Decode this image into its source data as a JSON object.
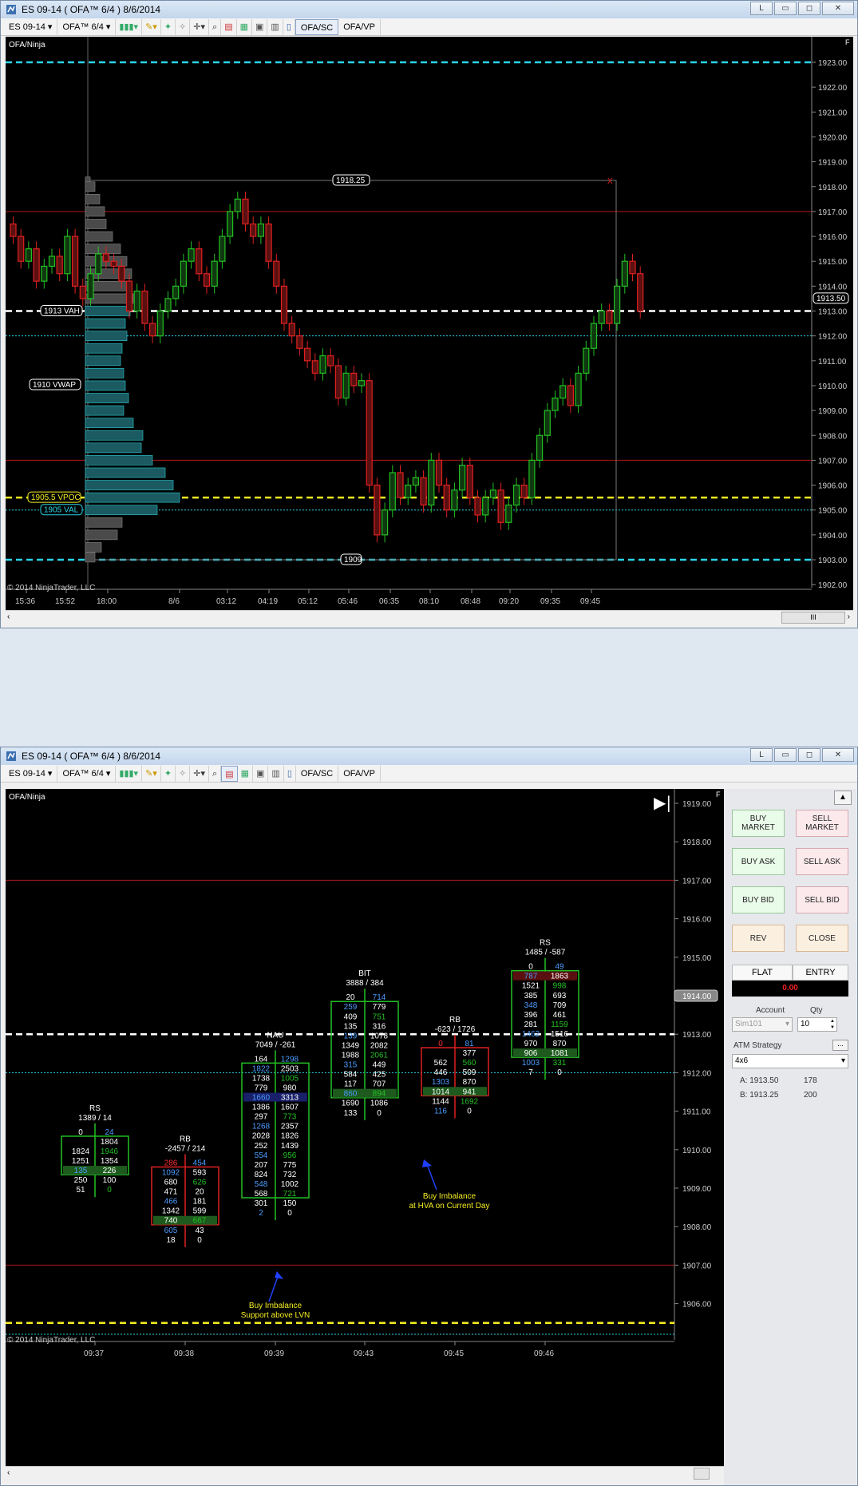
{
  "top_window": {
    "title": "ES 09-14 ( OFA™ 6/4 )  8/6/2014",
    "buttons": [
      "L",
      "▭",
      "◻",
      "✕"
    ],
    "toolbar": {
      "instrument": "ES 09-14",
      "template": "OFA™ 6/4",
      "tab1": "OFA/SC",
      "tab2": "OFA/VP"
    },
    "chart": {
      "label": "OFA/Ninja",
      "copyright": "© 2014 NinjaTrader, LLC",
      "price_box_top": "1918.25",
      "price_box_bottom": "1909",
      "last_price": "1913.50",
      "vwap": "1910 VWAP",
      "vah": "1913 VAH",
      "vpoc": "1905.5 VPOC",
      "val": "1905 VAL",
      "close_x": "X",
      "corner_f": "F",
      "scroll_thumb": "III",
      "y_ticks": [
        "1923.00",
        "1922.00",
        "1921.00",
        "1920.00",
        "1919.00",
        "1918.00",
        "1917.00",
        "1916.00",
        "1915.00",
        "1914.00",
        "1913.00",
        "1912.00",
        "1911.00",
        "1910.00",
        "1909.00",
        "1908.00",
        "1907.00",
        "1906.00",
        "1905.00",
        "1904.00",
        "1903.00",
        "1902.00"
      ],
      "x_ticks": [
        "15:36",
        "15:52",
        "18:00",
        "8/6",
        "03:12",
        "04:19",
        "05:12",
        "05:46",
        "06:35",
        "08:10",
        "08:48",
        "09:20",
        "09:35",
        "09:45"
      ]
    }
  },
  "bottom_window": {
    "title": "ES 09-14 ( OFA™ 6/4 )  8/6/2014",
    "buttons": [
      "L",
      "▭",
      "◻",
      "✕"
    ],
    "toolbar": {
      "instrument": "ES 09-14",
      "template": "OFA™ 6/4",
      "tab1": "OFA/SC",
      "tab2": "OFA/VP"
    },
    "chart": {
      "label": "OFA/Ninja",
      "copyright": "© 2014 NinjaTrader, LLC",
      "last_price": "1914.00",
      "corner_f": "F",
      "y_ticks": [
        "1919.00",
        "1918.00",
        "1917.00",
        "1916.00",
        "1915.00",
        "1914.00",
        "1913.00",
        "1912.00",
        "1911.00",
        "1910.00",
        "1909.00",
        "1908.00",
        "1907.00",
        "1906.00"
      ],
      "x_ticks": [
        "09:37",
        "09:38",
        "09:39",
        "09:43",
        "09:45",
        "09:46"
      ]
    },
    "footprint_bars": [
      {
        "label": "RS",
        "summary": "1389 / 14",
        "rows": [
          [
            "0",
            "24"
          ],
          [
            "",
            "1804"
          ],
          [
            "1824",
            "1946"
          ],
          [
            "1251",
            "1354"
          ],
          [
            "135",
            "226"
          ],
          [
            "250",
            "100"
          ],
          [
            "51",
            "0"
          ]
        ]
      },
      {
        "label": "RB",
        "summary": "-2457 / 214",
        "rows": [
          [
            "286",
            "454"
          ],
          [
            "1092",
            "593"
          ],
          [
            "680",
            "626"
          ],
          [
            "471",
            "20"
          ],
          [
            "466",
            "181"
          ],
          [
            "1342",
            "599"
          ],
          [
            "740",
            "667"
          ],
          [
            "605",
            "43"
          ],
          [
            "18",
            "0"
          ]
        ]
      },
      {
        "label": "NAU",
        "summary": "7049 / -261",
        "rows": [
          [
            "164",
            "1298"
          ],
          [
            "1822",
            "2503"
          ],
          [
            "1738",
            "1005"
          ],
          [
            "779",
            "980"
          ],
          [
            "1660",
            "3313"
          ],
          [
            "1386",
            "1607"
          ],
          [
            "297",
            "773"
          ],
          [
            "1268",
            "2357"
          ],
          [
            "2028",
            "1826"
          ],
          [
            "252",
            "1439"
          ],
          [
            "554",
            "956"
          ],
          [
            "207",
            "775"
          ],
          [
            "824",
            "732"
          ],
          [
            "548",
            "1002"
          ],
          [
            "568",
            "721"
          ],
          [
            "301",
            "150"
          ],
          [
            "2",
            "0"
          ]
        ]
      },
      {
        "label": "BIT",
        "summary": "3888 / 384",
        "rows": [
          [
            "20",
            "714"
          ],
          [
            "259",
            "779"
          ],
          [
            "409",
            "751"
          ],
          [
            "135",
            "316"
          ],
          [
            "139",
            "1078"
          ],
          [
            "1349",
            "2082"
          ],
          [
            "1988",
            "2061"
          ],
          [
            "315",
            "449"
          ],
          [
            "584",
            "425"
          ],
          [
            "117",
            "707"
          ],
          [
            "860",
            "894"
          ],
          [
            "1690",
            "1086"
          ],
          [
            "133",
            "0"
          ]
        ]
      },
      {
        "label": "RB",
        "summary": "-623 / 1726",
        "rows": [
          [
            "0",
            "81"
          ],
          [
            "",
            "377"
          ],
          [
            "562",
            "560"
          ],
          [
            "446",
            "509"
          ],
          [
            "1303",
            "870"
          ],
          [
            "1014",
            "941"
          ],
          [
            "1144",
            "1692"
          ],
          [
            "116",
            "0"
          ]
        ]
      },
      {
        "label": "RS",
        "summary": "1485 / -587",
        "rows": [
          [
            "0",
            "49"
          ],
          [
            "787",
            "1863"
          ],
          [
            "1521",
            "998"
          ],
          [
            "385",
            "693"
          ],
          [
            "348",
            "709"
          ],
          [
            "396",
            "461"
          ],
          [
            "281",
            "1159"
          ],
          [
            "1462",
            "1516"
          ],
          [
            "970",
            "870"
          ],
          [
            "906",
            "1081"
          ],
          [
            "1003",
            "331"
          ],
          [
            "7",
            "0"
          ]
        ]
      }
    ],
    "annotations": [
      {
        "text": "Buy Imbalance\nSupport above LVN"
      },
      {
        "text": "Buy Imbalance\nat HVA on Current Day"
      }
    ],
    "order_panel": {
      "buy_market": "BUY MARKET",
      "sell_market": "SELL MARKET",
      "buy_ask": "BUY ASK",
      "sell_ask": "SELL ASK",
      "buy_bid": "BUY BID",
      "sell_bid": "SELL BID",
      "rev": "REV",
      "close": "CLOSE",
      "flat": "FLAT",
      "entry": "ENTRY",
      "pnl": "0.00",
      "account_label": "Account",
      "qty_label": "Qty",
      "account_value": "Sim101",
      "qty_value": "10",
      "atm_label": "ATM Strategy",
      "atm_value": "4x6",
      "ask_label": "A: 1913.50",
      "ask_size": "178",
      "bid_label": "B: 1913.25",
      "bid_size": "200"
    }
  }
}
